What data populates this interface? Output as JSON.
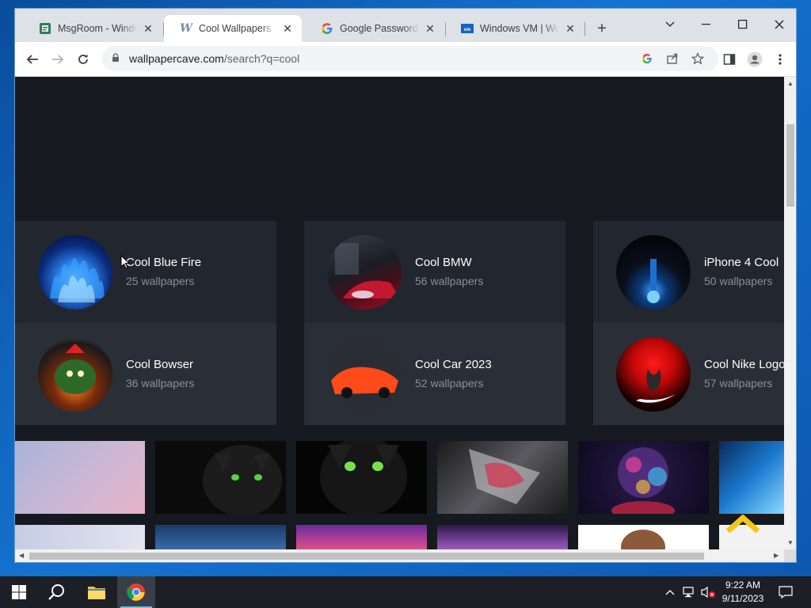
{
  "browser": {
    "tabs": [
      {
        "title": "MsgRoom - Windows",
        "favicon": "msgroom-icon",
        "active": false
      },
      {
        "title": "Cool Wallpapers - Wallpaper Cave",
        "favicon": "wallpapercave-icon",
        "active": true
      },
      {
        "title": "Google Password Manager",
        "favicon": "google-icon",
        "active": false
      },
      {
        "title": "Windows VM | Workspace",
        "favicon": "vmware-icon",
        "active": false
      }
    ],
    "new_tab_label": "+",
    "window_controls": [
      "chevron-down-icon",
      "minimize-icon",
      "maximize-icon",
      "close-icon"
    ],
    "url": {
      "domain": "wallpapercave.com",
      "path": "/search?q=cool"
    },
    "toolbar_icons": [
      "google-lens-icon",
      "share-icon",
      "star-icon",
      "side-panel-icon",
      "profile-icon",
      "menu-icon"
    ]
  },
  "page": {
    "categories": [
      {
        "name": "Cool Blue Fire",
        "count": "25 wallpapers"
      },
      {
        "name": "Cool BMW",
        "count": "56 wallpapers"
      },
      {
        "name": "iPhone 4 Cool",
        "count": "50 wallpapers"
      },
      {
        "name": "Cool Bowser",
        "count": "36 wallpapers"
      },
      {
        "name": "Cool Car 2023",
        "count": "52 wallpapers"
      },
      {
        "name": "Cool Nike Logo",
        "count": "57 wallpapers"
      }
    ],
    "accent": "#f5c518"
  },
  "taskbar": {
    "pinned": [
      "windows-start-icon",
      "search-icon",
      "file-explorer-icon",
      "chrome-icon"
    ],
    "clock_time": "9:22 AM",
    "clock_date": "9/11/2023"
  }
}
